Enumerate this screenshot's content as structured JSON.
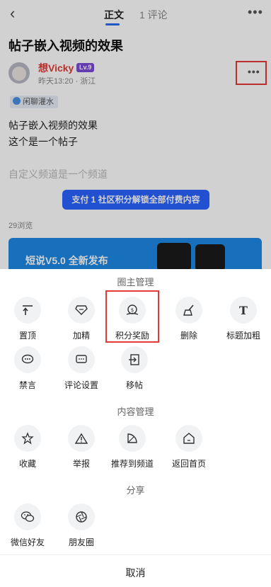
{
  "topbar": {
    "tab_main": "正文",
    "tab_comment": "1 评论"
  },
  "post": {
    "title": "帖子嵌入视频的效果",
    "author": "想Vicky",
    "level": "Lv.9",
    "meta": "昨天13:20 · 浙江",
    "tag": "闲聊灌水",
    "body_line1": "帖子嵌入视频的效果",
    "body_line2": "这个是一个帖子",
    "body_line3": "自定义频道是一个频道",
    "pay_button": "支付 1 社区积分解锁全部付费内容",
    "views": "29浏览",
    "banner_text": "短说V5.0 全新发布"
  },
  "sheet": {
    "section1_title": "圈主管理",
    "section1_items": [
      "置顶",
      "加精",
      "积分奖励",
      "删除",
      "标题加粗",
      "禁言",
      "评论设置",
      "移帖"
    ],
    "section2_title": "内容管理",
    "section2_items": [
      "收藏",
      "举报",
      "推荐到频道",
      "返回首页"
    ],
    "section3_title": "分享",
    "section3_items": [
      "微信好友",
      "朋友圈"
    ],
    "cancel": "取消"
  }
}
